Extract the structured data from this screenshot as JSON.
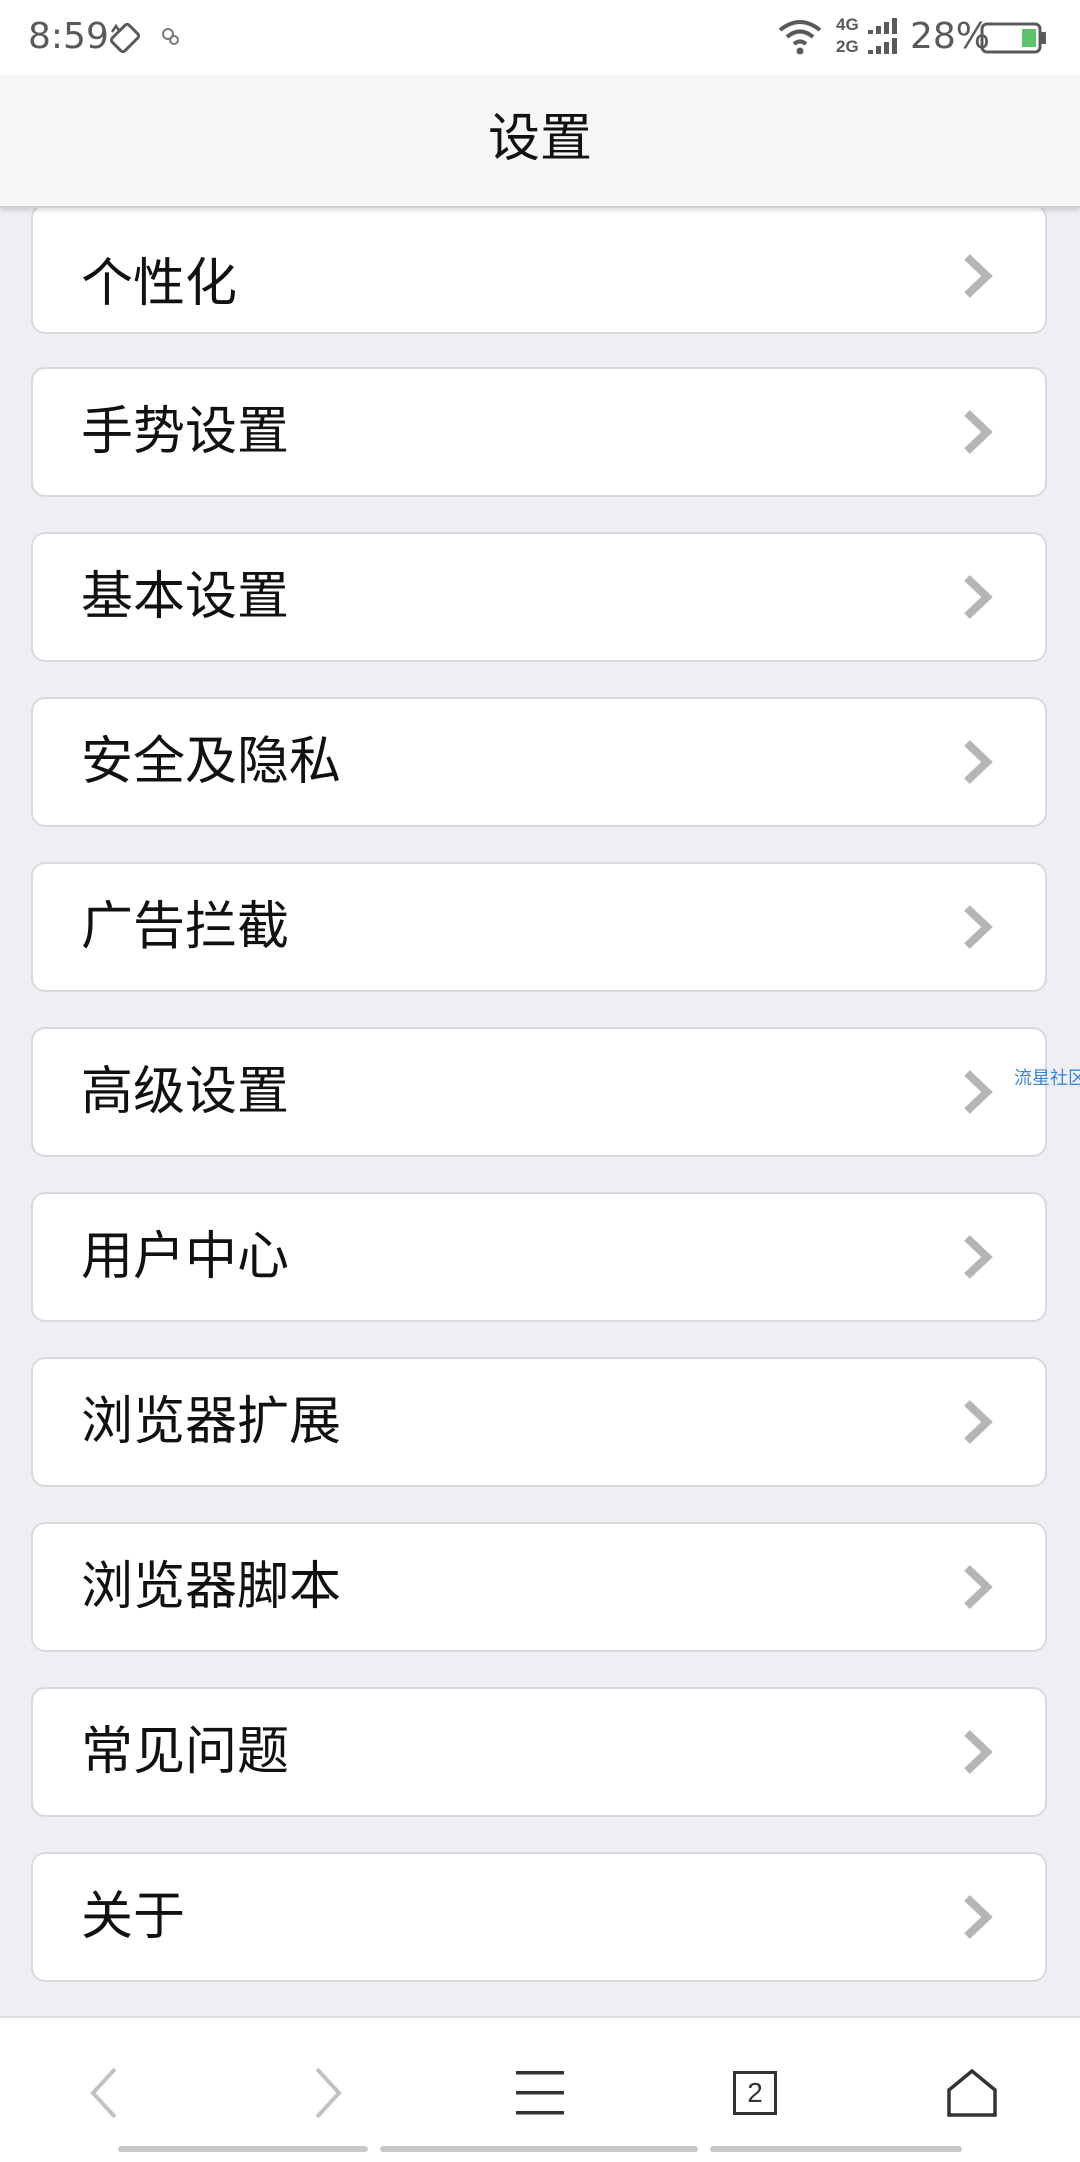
{
  "status_bar": {
    "time": "8:59",
    "network_top": "4G",
    "network_bottom": "2G",
    "battery_percent": "28%",
    "icons": [
      "rotation-lock-icon",
      "notification-icon",
      "wifi-icon",
      "signal-icon",
      "battery-icon"
    ]
  },
  "header": {
    "title": "设置"
  },
  "menu": {
    "items": [
      {
        "label": "个性化"
      },
      {
        "label": "手势设置"
      },
      {
        "label": "基本设置"
      },
      {
        "label": "安全及隐私"
      },
      {
        "label": "广告拦截"
      },
      {
        "label": "高级设置"
      },
      {
        "label": "用户中心"
      },
      {
        "label": "浏览器扩展"
      },
      {
        "label": "浏览器脚本"
      },
      {
        "label": "常见问题"
      },
      {
        "label": "关于"
      }
    ]
  },
  "side_link": "流星社区",
  "toolbar": {
    "tab_count": "2",
    "icons": [
      "back-icon",
      "forward-icon",
      "menu-icon",
      "tabs-icon",
      "home-icon"
    ]
  },
  "colors": {
    "background": "#efeff3",
    "card": "#ffffff",
    "chevron": "#b5b5b5",
    "battery_fill": "#5cc46a",
    "side_link": "#3a86d6"
  }
}
